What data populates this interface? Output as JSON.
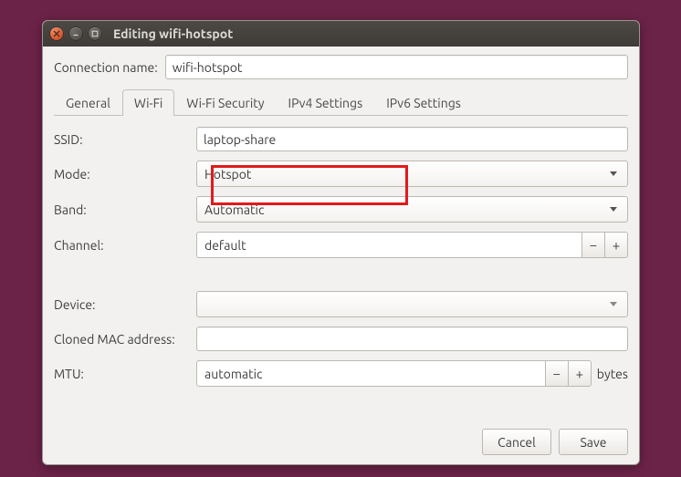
{
  "window": {
    "title": "Editing wifi-hotspot"
  },
  "connection": {
    "name_label": "Connection name:",
    "name_value": "wifi-hotspot"
  },
  "tabs": {
    "general": "General",
    "wifi": "Wi-Fi",
    "wifi_security": "Wi-Fi Security",
    "ipv4": "IPv4 Settings",
    "ipv6": "IPv6 Settings",
    "active": "wifi"
  },
  "wifi_tab": {
    "ssid_label": "SSID:",
    "ssid_value": "laptop-share",
    "mode_label": "Mode:",
    "mode_value": "Hotspot",
    "band_label": "Band:",
    "band_value": "Automatic",
    "channel_label": "Channel:",
    "channel_value": "default",
    "device_label": "Device:",
    "device_value": "",
    "cloned_mac_label": "Cloned MAC address:",
    "cloned_mac_value": "",
    "mtu_label": "MTU:",
    "mtu_value": "automatic",
    "mtu_unit": "bytes"
  },
  "footer": {
    "cancel": "Cancel",
    "save": "Save"
  }
}
